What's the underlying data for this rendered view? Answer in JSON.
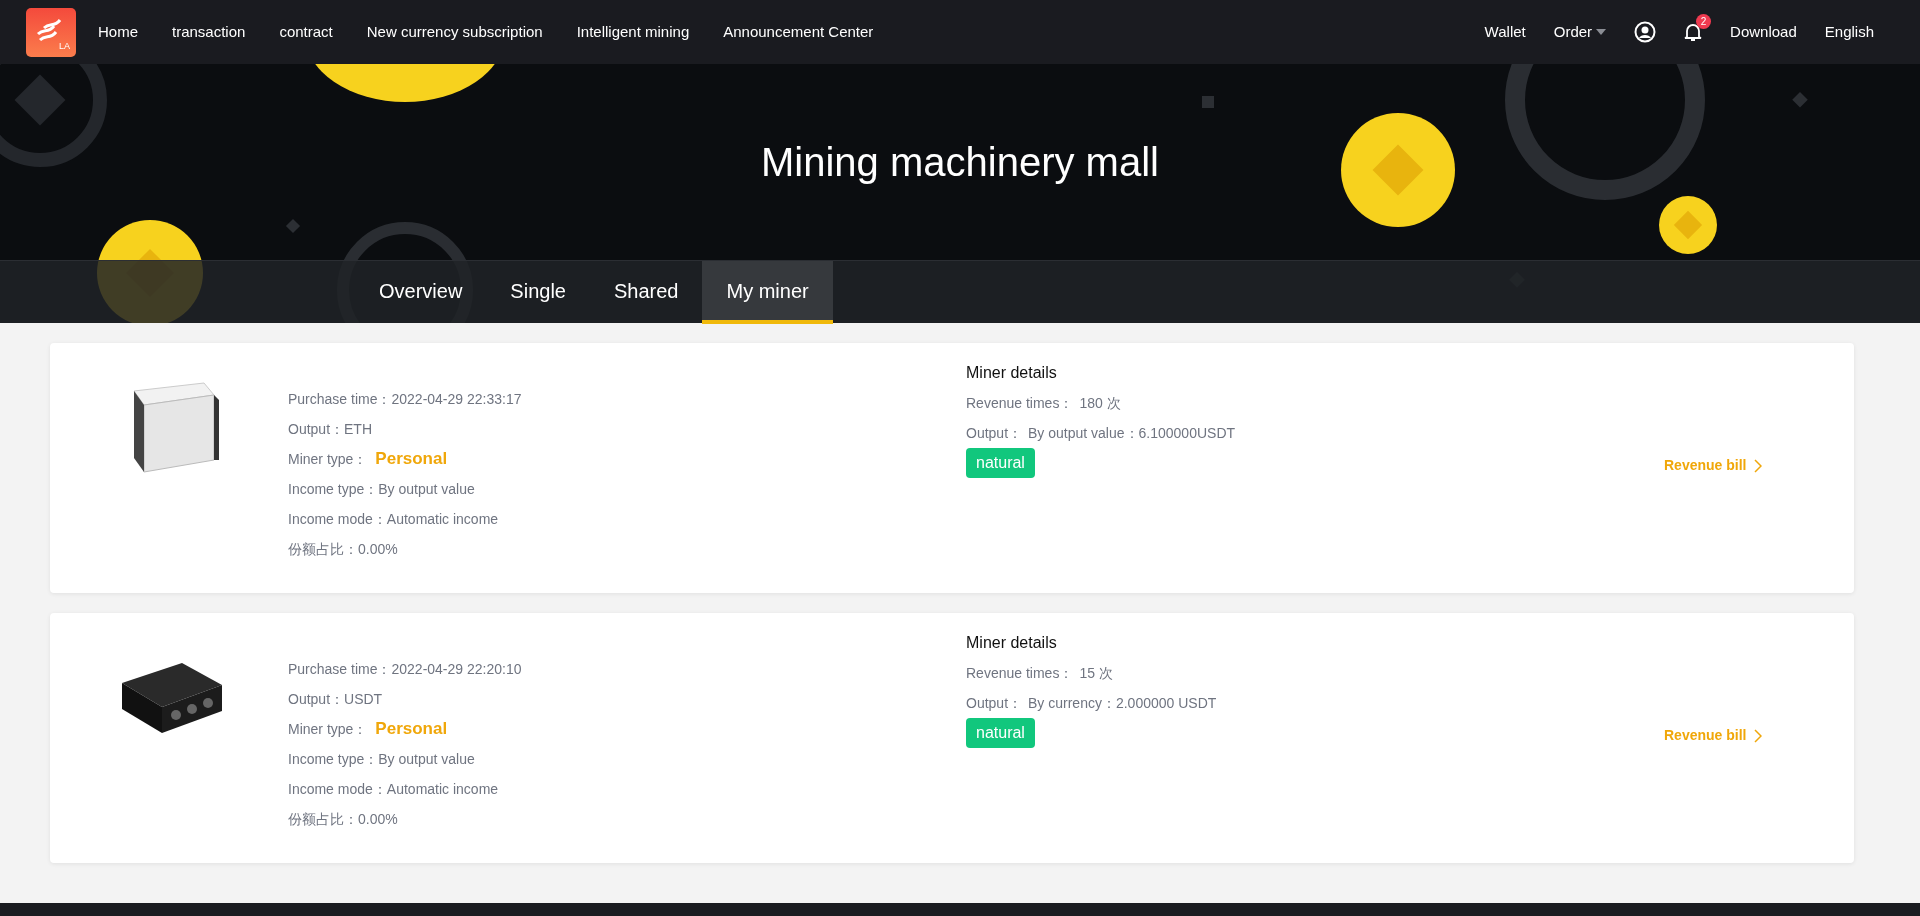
{
  "nav": {
    "items": [
      {
        "label": "Home"
      },
      {
        "label": "transaction"
      },
      {
        "label": "contract"
      },
      {
        "label": "New currency subscription"
      },
      {
        "label": "Intelligent mining"
      },
      {
        "label": "Announcement Center"
      }
    ],
    "right": [
      {
        "kind": "link",
        "label": "Wallet"
      },
      {
        "kind": "dropdown",
        "label": "Order"
      },
      {
        "kind": "user"
      },
      {
        "kind": "bell",
        "badge": "2"
      },
      {
        "kind": "link",
        "label": "Download"
      },
      {
        "kind": "link",
        "label": "English"
      }
    ],
    "logo_text": "LA"
  },
  "hero": {
    "title": "Mining machinery mall"
  },
  "tabs": [
    {
      "label": "Overview",
      "selected": false
    },
    {
      "label": "Single",
      "selected": false
    },
    {
      "label": "Shared",
      "selected": false
    },
    {
      "label": "My miner",
      "selected": true
    }
  ],
  "miners": [
    {
      "kind": "silver",
      "fields": [
        {
          "label": "Purchase time：",
          "value": "2022-04-29 22:33:17",
          "kind": "plain"
        },
        {
          "label": "Output：",
          "value": "ETH",
          "kind": "plain"
        },
        {
          "label": "Miner type：",
          "value": "Personal",
          "kind": "highlight"
        },
        {
          "label": "Income type：",
          "value": "By output value",
          "kind": "plain"
        },
        {
          "label": "Income mode：",
          "value": "Automatic income",
          "kind": "plain"
        },
        {
          "label": "份额占比：",
          "value": "0.00%",
          "kind": "plain"
        }
      ],
      "details_title": "Miner details",
      "details": [
        {
          "label": "Revenue times：",
          "value": "180 次"
        },
        {
          "label": "Output：",
          "value": "By output value：6.100000USDT"
        }
      ],
      "tag": "natural",
      "link": "Revenue bill"
    },
    {
      "kind": "black",
      "fields": [
        {
          "label": "Purchase time：",
          "value": "2022-04-29 22:20:10",
          "kind": "plain"
        },
        {
          "label": "Output：",
          "value": "USDT",
          "kind": "plain"
        },
        {
          "label": "Miner type：",
          "value": "Personal",
          "kind": "highlight"
        },
        {
          "label": "Income type：",
          "value": "By output value",
          "kind": "plain"
        },
        {
          "label": "Income mode：",
          "value": "Automatic income",
          "kind": "plain"
        },
        {
          "label": "份额占比：",
          "value": "0.00%",
          "kind": "plain"
        }
      ],
      "details_title": "Miner details",
      "details": [
        {
          "label": "Revenue times：",
          "value": "15 次"
        },
        {
          "label": "Output：",
          "value": "By currency：2.000000 USDT"
        }
      ],
      "tag": "natural",
      "link": "Revenue bill"
    }
  ]
}
